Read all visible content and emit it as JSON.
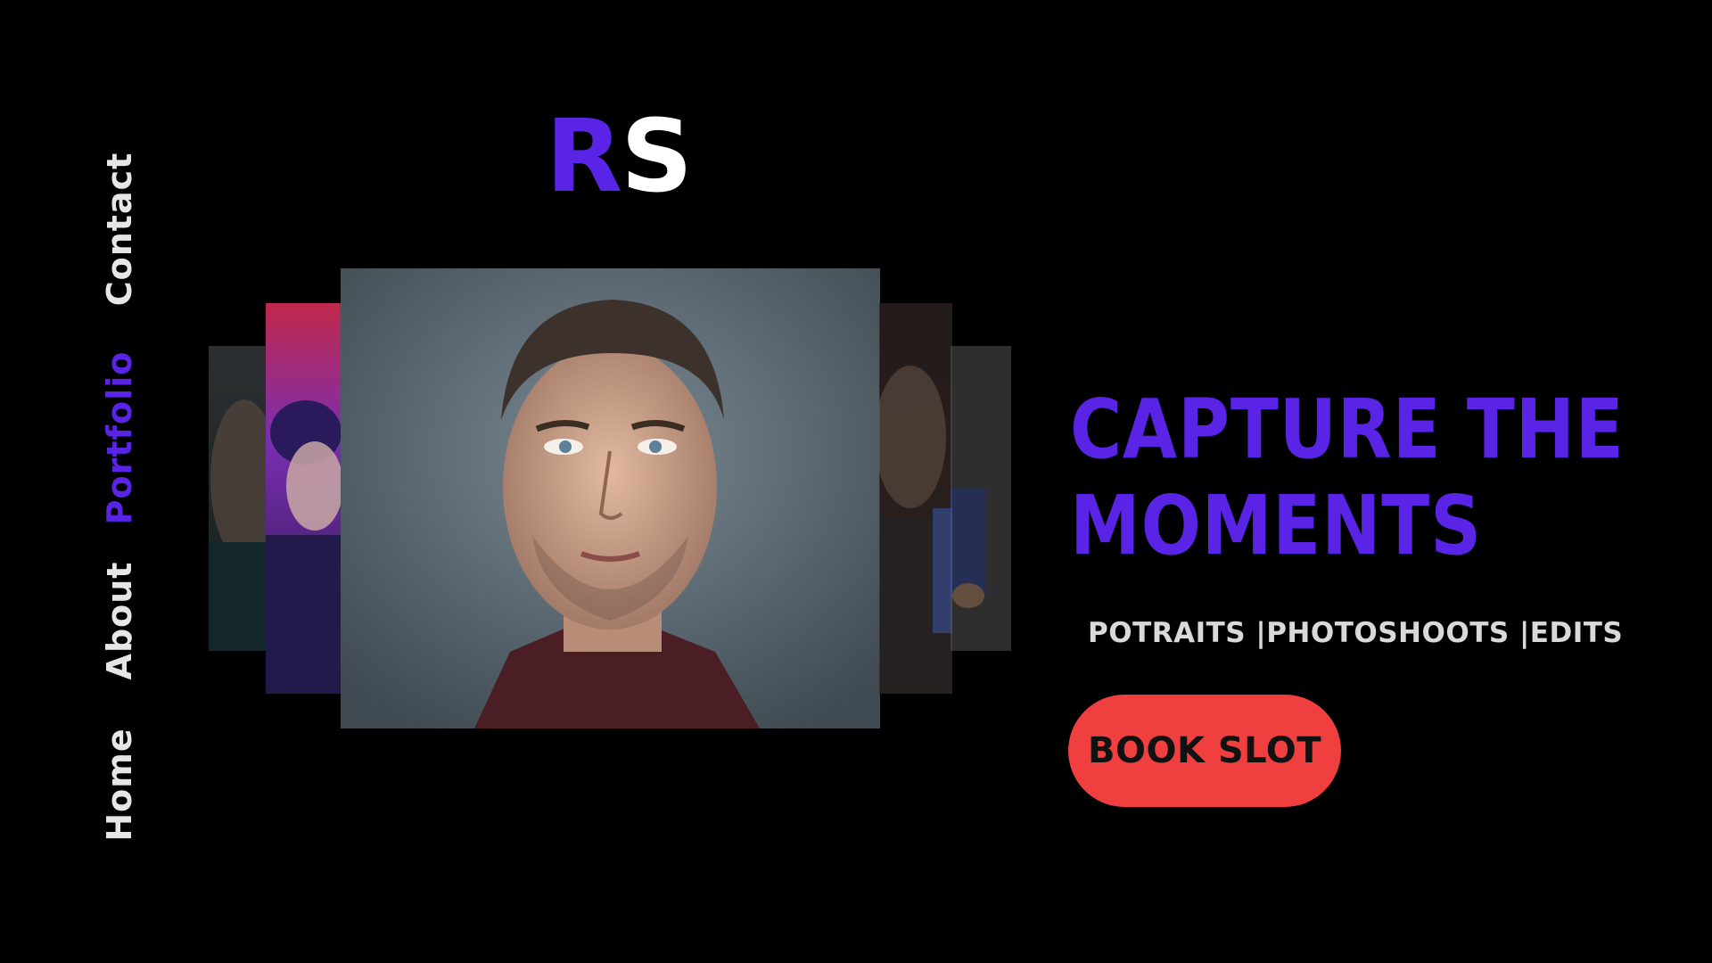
{
  "nav": {
    "items": [
      {
        "label": "Contact"
      },
      {
        "label": "Portfolio",
        "active": true
      },
      {
        "label": "About"
      },
      {
        "label": "Home"
      }
    ]
  },
  "logo": {
    "first": "R",
    "second": "S"
  },
  "hero": {
    "headline_line1": "CAPTURE THE",
    "headline_line2": "MOMENTS",
    "services": "POTRAITS |PHOTOSHOOTS |EDITS",
    "cta_label": "BOOK SLOT"
  },
  "gallery": {
    "photos": [
      {
        "name": "portrait-photo-far-left"
      },
      {
        "name": "portrait-photo-mid-left"
      },
      {
        "name": "portrait-photo-main"
      },
      {
        "name": "portrait-photo-mid-right"
      },
      {
        "name": "portrait-photo-far-right"
      }
    ]
  },
  "colors": {
    "background": "#000000",
    "accent": "#5a24e6",
    "cta": "#ef3f3f",
    "nav_text": "#e6e6e6"
  }
}
